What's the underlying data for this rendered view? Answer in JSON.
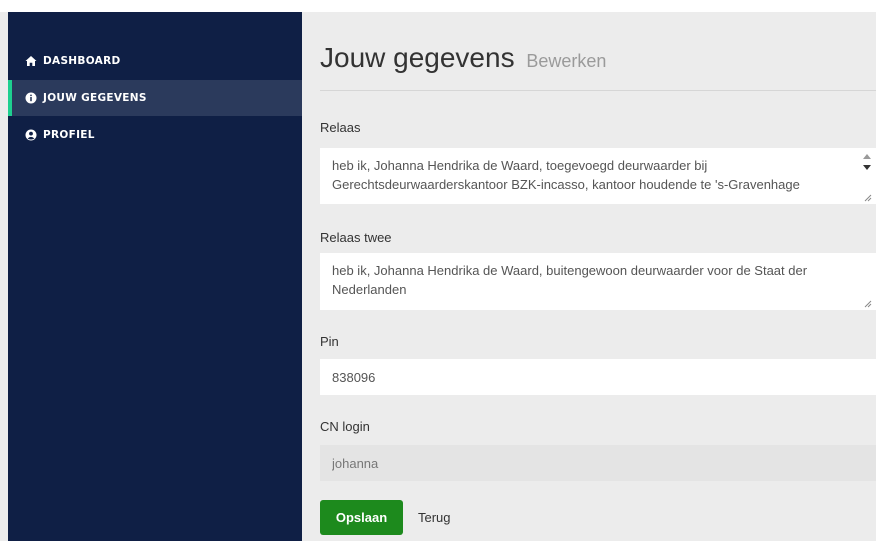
{
  "sidebar": {
    "items": [
      {
        "label": "DASHBOARD",
        "icon": "home-icon"
      },
      {
        "label": "JOUW GEGEVENS",
        "icon": "info-icon",
        "active": true
      },
      {
        "label": "PROFIEL",
        "icon": "user-circle-icon"
      }
    ]
  },
  "page": {
    "title": "Jouw gegevens",
    "subtitle": "Bewerken"
  },
  "form": {
    "relaas": {
      "label": "Relaas",
      "value": "heb ik, Johanna Hendrika de Waard, toegevoegd deurwaarder bij Gerechtsdeurwaarderskantoor BZK-incasso, kantoor houdende te 's-Gravenhage"
    },
    "relaas_twee": {
      "label": "Relaas twee",
      "value": "heb ik, Johanna Hendrika de Waard, buitengewoon deurwaarder voor de Staat der Nederlanden"
    },
    "pin": {
      "label": "Pin",
      "value": "838096"
    },
    "cn_login": {
      "label": "CN login",
      "value": "johanna"
    }
  },
  "actions": {
    "save_label": "Opslaan",
    "back_label": "Terug"
  },
  "colors": {
    "sidebar_bg": "#0f1f45",
    "sidebar_active_bg": "#2b3a5c",
    "active_marker": "#1ecf8f",
    "save_button": "#1d8a1d",
    "page_bg": "#ececec"
  }
}
